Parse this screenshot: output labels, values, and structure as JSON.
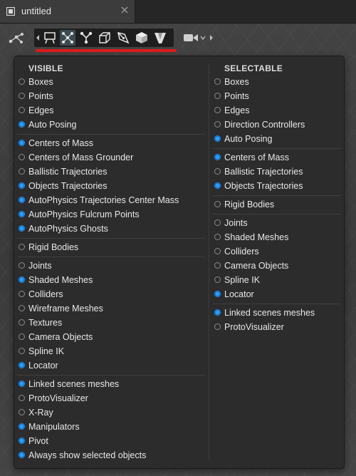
{
  "tab": {
    "title": "untitled"
  },
  "toolbar": {
    "buttons": [
      "rig-icon",
      "presentation-icon",
      "graph-nodes-icon",
      "branch-icon",
      "cube-outline-icon",
      "pen-tool-icon",
      "cube-solid-icon",
      "v-shape-icon",
      "camera-icon"
    ]
  },
  "visible": {
    "header": "VISIBLE",
    "groups": [
      [
        {
          "label": "Boxes",
          "on": false
        },
        {
          "label": "Points",
          "on": false
        },
        {
          "label": "Edges",
          "on": false
        },
        {
          "label": "Auto Posing",
          "on": true
        }
      ],
      [
        {
          "label": "Centers of Mass",
          "on": true
        },
        {
          "label": "Centers of Mass Grounder",
          "on": false
        },
        {
          "label": "Ballistic Trajectories",
          "on": false
        },
        {
          "label": "Objects Trajectories",
          "on": true
        },
        {
          "label": "AutoPhysics Trajectories Center Mass",
          "on": true
        },
        {
          "label": "AutoPhysics Fulcrum Points",
          "on": true
        },
        {
          "label": "AutoPhysics Ghosts",
          "on": true
        }
      ],
      [
        {
          "label": "Rigid Bodies",
          "on": false
        }
      ],
      [
        {
          "label": "Joints",
          "on": false
        },
        {
          "label": "Shaded Meshes",
          "on": true
        },
        {
          "label": "Colliders",
          "on": false
        },
        {
          "label": "Wireframe Meshes",
          "on": false
        },
        {
          "label": "Textures",
          "on": false
        },
        {
          "label": "Camera Objects",
          "on": false
        },
        {
          "label": "Spline IK",
          "on": false
        },
        {
          "label": "Locator",
          "on": true
        }
      ],
      [
        {
          "label": "Linked scenes meshes",
          "on": true
        },
        {
          "label": "ProtoVisualizer",
          "on": false
        },
        {
          "label": "X-Ray",
          "on": false
        },
        {
          "label": "Manipulators",
          "on": true
        },
        {
          "label": "Pivot",
          "on": true
        },
        {
          "label": "Always show selected objects",
          "on": true
        }
      ]
    ]
  },
  "selectable": {
    "header": "SELECTABLE",
    "groups": [
      [
        {
          "label": "Boxes",
          "on": false
        },
        {
          "label": "Points",
          "on": false
        },
        {
          "label": "Edges",
          "on": false
        },
        {
          "label": "Direction Controllers",
          "on": false
        },
        {
          "label": "Auto Posing",
          "on": true
        }
      ],
      [
        {
          "label": "Centers of Mass",
          "on": true
        },
        {
          "label": "Ballistic Trajectories",
          "on": false
        },
        {
          "label": "Objects Trajectories",
          "on": true
        }
      ],
      [
        {
          "label": "Rigid Bodies",
          "on": false
        }
      ],
      [
        {
          "label": "Joints",
          "on": false
        },
        {
          "label": "Shaded Meshes",
          "on": false
        },
        {
          "label": "Colliders",
          "on": false
        },
        {
          "label": "Camera Objects",
          "on": false
        },
        {
          "label": "Spline IK",
          "on": false
        },
        {
          "label": "Locator",
          "on": true
        }
      ],
      [
        {
          "label": "Linked scenes meshes",
          "on": true
        },
        {
          "label": "ProtoVisualizer",
          "on": false
        }
      ]
    ]
  },
  "colors": {
    "accent": "#1e90ff",
    "highlight": "#e01b1b",
    "panel": "#2c2c2c"
  }
}
